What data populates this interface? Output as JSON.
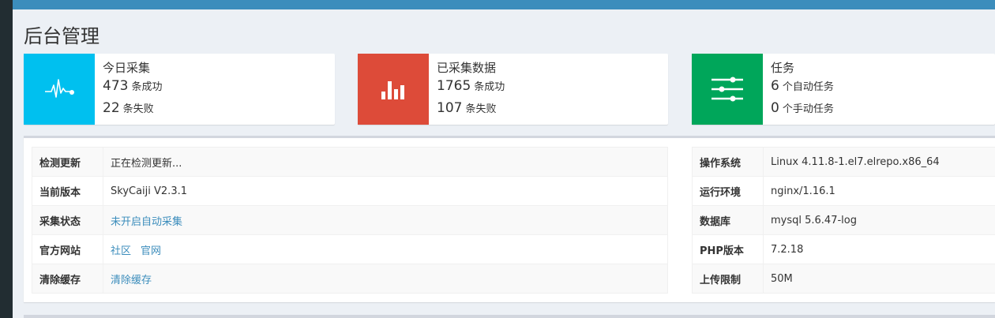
{
  "page": {
    "title": "后台管理"
  },
  "stats": [
    {
      "label": "今日采集",
      "rows": [
        {
          "num": "473",
          "unit": "条成功"
        },
        {
          "num": "22",
          "unit": "条失败"
        }
      ],
      "icon": "activity-icon",
      "color": "#00c0ef"
    },
    {
      "label": "已采集数据",
      "rows": [
        {
          "num": "1765",
          "unit": "条成功"
        },
        {
          "num": "107",
          "unit": "条失败"
        }
      ],
      "icon": "bar-chart-icon",
      "color": "#dd4b39"
    },
    {
      "label": "任务",
      "rows": [
        {
          "num": "6",
          "unit": "个自动任务"
        },
        {
          "num": "0",
          "unit": "个手动任务"
        }
      ],
      "icon": "sliders-icon",
      "color": "#00a65a"
    }
  ],
  "left_table": {
    "rows": [
      {
        "label": "检测更新",
        "value": "正在检测更新..."
      },
      {
        "label": "当前版本",
        "value": "SkyCaiji V2.3.1"
      },
      {
        "label": "采集状态",
        "value": "未开启自动采集"
      },
      {
        "label": "官方网站",
        "links": [
          "社区",
          "官网"
        ]
      },
      {
        "label": "清除缓存",
        "value": "清除缓存"
      }
    ]
  },
  "right_table": {
    "rows": [
      {
        "label": "操作系统",
        "value": "Linux 4.11.8-1.el7.elrepo.x86_64"
      },
      {
        "label": "运行环境",
        "value": "nginx/1.16.1"
      },
      {
        "label": "数据库",
        "value": "mysql 5.6.47-log"
      },
      {
        "label": "PHP版本",
        "value": "7.2.18"
      },
      {
        "label": "上传限制",
        "value": "50M"
      }
    ]
  }
}
